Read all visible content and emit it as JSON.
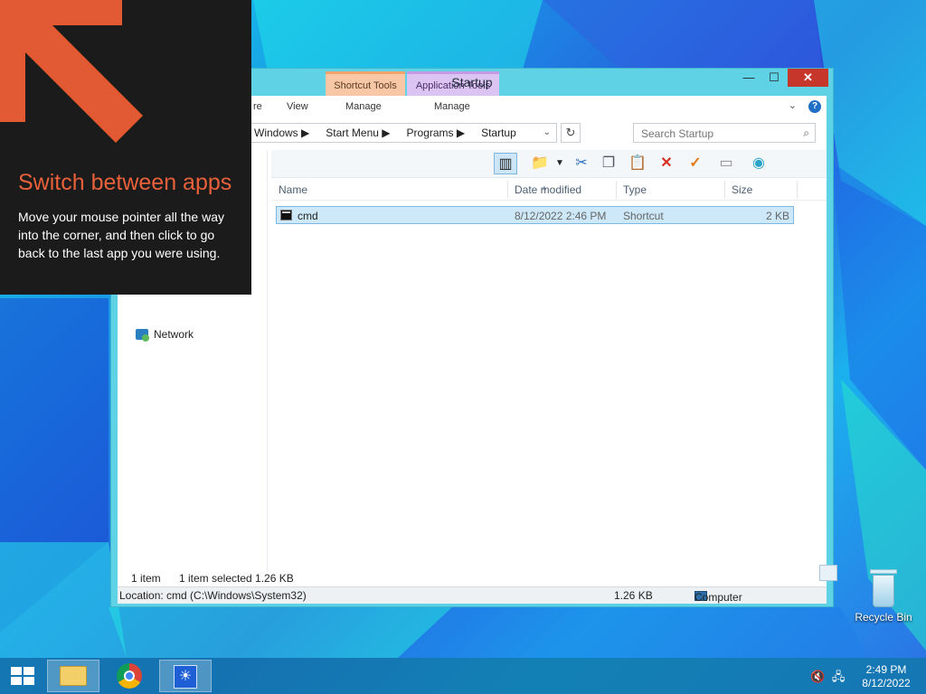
{
  "window": {
    "title": "Startup",
    "ctx_tabs": {
      "shortcut": "Shortcut Tools",
      "application": "Application Tools"
    },
    "ribbon_tabs": [
      "re",
      "View",
      "Manage",
      "Manage"
    ],
    "buttons": {
      "minimize": "—",
      "maximize": "☐",
      "close": "✕"
    }
  },
  "address": {
    "crumbs": [
      "Windows",
      "Start Menu",
      "Programs",
      "Startup"
    ],
    "separator": "▶",
    "refresh": "↻",
    "search_placeholder": "Search Startup"
  },
  "nav": {
    "network": "Network"
  },
  "columns": {
    "name": "Name",
    "date": "Date modified",
    "type": "Type",
    "size": "Size"
  },
  "files": [
    {
      "name": "cmd",
      "date": "8/12/2022 2:46 PM",
      "type": "Shortcut",
      "size": "2 KB"
    }
  ],
  "status": {
    "count": "1 item",
    "selected": "1 item selected  1.26 KB"
  },
  "statusbar": {
    "location": "Location: cmd (C:\\Windows\\System32)",
    "size": "1.26 KB",
    "computer": "Computer"
  },
  "tip": {
    "title": "Switch between apps",
    "body": "Move your mouse pointer all the way into the corner, and then click to go back to the last app you were using."
  },
  "desktop": {
    "recycle_bin": "Recycle Bin"
  },
  "clock": {
    "time": "2:49 PM",
    "date": "8/12/2022"
  },
  "colors": {
    "accent": "#e8603a",
    "close": "#c7362b",
    "window_frame": "#5fd2e6",
    "selection": "#cde8f8"
  },
  "icons": [
    "search-icon",
    "refresh-icon",
    "cut-icon",
    "copy-icon",
    "paste-icon",
    "delete-icon",
    "check-icon",
    "rename-icon",
    "network-icon",
    "computer-icon",
    "recycle-bin-icon",
    "start-icon",
    "file-explorer-icon",
    "chrome-icon",
    "weather-icon",
    "volume-muted-icon",
    "network-tray-icon"
  ]
}
